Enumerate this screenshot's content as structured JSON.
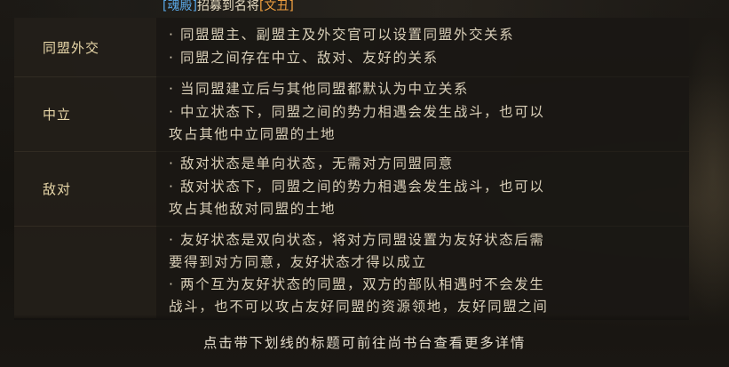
{
  "ticker": {
    "org": "[魂殿]",
    "text": "招募到名将",
    "general": "[文丑]"
  },
  "rows": [
    {
      "label": "同盟外交",
      "lines": [
        "· 同盟盟主、副盟主及外交官可以设置同盟外交关系",
        "· 同盟之间存在中立、敌对、友好的关系"
      ]
    },
    {
      "label": "中立",
      "lines": [
        "· 当同盟建立后与其他同盟都默认为中立关系",
        "· 中立状态下，同盟之间的势力相遇会发生战斗，也可以",
        "攻占其他中立同盟的土地"
      ]
    },
    {
      "label": "敌对",
      "lines": [
        "· 敌对状态是单向状态，无需对方同盟同意",
        "· 敌对状态下，同盟之间的势力相遇会发生战斗，也可以",
        "攻占其他敌对同盟的土地"
      ]
    },
    {
      "label": "",
      "lines": [
        "· 友好状态是双向状态，将对方同盟设置为友好状态后需",
        "要得到对方同意，友好状态才得以成立",
        "· 两个互为友好状态的同盟，双方的部队相遇时不会发生",
        "战斗，也不可以攻占友好同盟的资源领地，友好同盟之间"
      ]
    }
  ],
  "footer": "点击带下划线的标题可前往尚书台查看更多详情"
}
